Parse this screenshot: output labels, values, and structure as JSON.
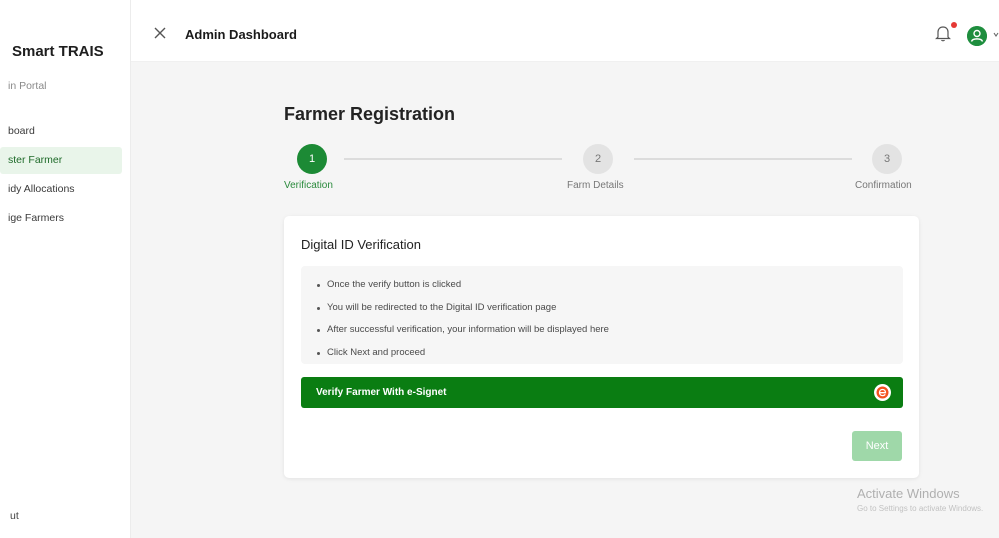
{
  "sidebar": {
    "brand": "Smart TRAIS",
    "portal": "in Portal",
    "items": [
      {
        "label": "board",
        "active": false
      },
      {
        "label": "ster Farmer",
        "active": true
      },
      {
        "label": "idy Allocations",
        "active": false
      },
      {
        "label": "ige Farmers",
        "active": false
      }
    ],
    "logout": "ut"
  },
  "topbar": {
    "close_icon": "close-icon",
    "title": "Admin Dashboard",
    "bell_icon": "bell-icon",
    "avatar_icon": "user-icon"
  },
  "main": {
    "page_title": "Farmer Registration",
    "steps": [
      {
        "number": "1",
        "label": "Verification",
        "status": "active"
      },
      {
        "number": "2",
        "label": "Farm Details",
        "status": "inactive"
      },
      {
        "number": "3",
        "label": "Confirmation",
        "status": "inactive"
      }
    ],
    "card": {
      "title": "Digital ID Verification",
      "instructions": [
        "Once the verify button is clicked",
        "You will be redirected to the Digital ID verification page",
        "After successful verification, your information will be displayed here",
        "Click Next and proceed"
      ],
      "verify_button": "Verify Farmer With e-Signet",
      "next_button": "Next"
    }
  },
  "watermark": {
    "line1": "Activate Windows",
    "line2": "Go to Settings to activate Windows."
  },
  "colors": {
    "primary_green": "#0a7d12",
    "step_active": "#1c8a35",
    "next_disabled": "#9fd8a9",
    "notification_dot": "#e53935"
  }
}
